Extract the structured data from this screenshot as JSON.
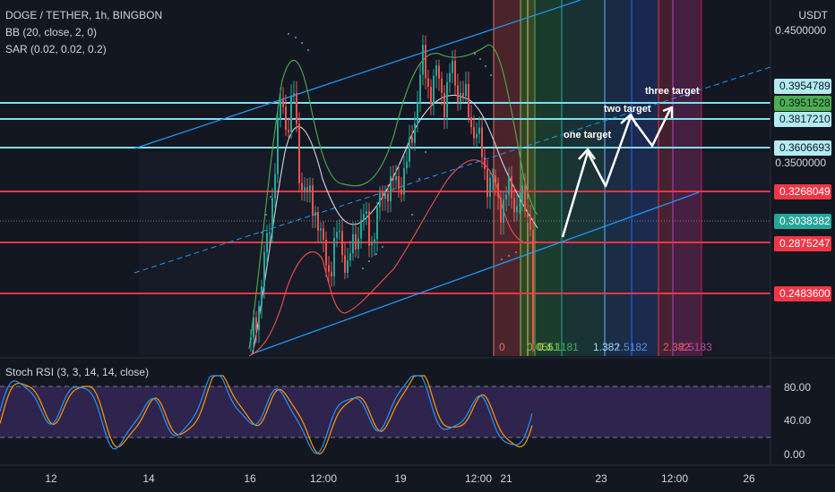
{
  "header": {
    "symbol": "DOGE / TETHER, 1h, BINGBON",
    "bb": "BB (20, close, 2, 0)",
    "sar": "SAR (0.02, 0.02, 0.2)",
    "stoch": "Stoch RSI (3, 3, 14, 14, close)"
  },
  "axis": {
    "currency": "USDT",
    "ticks": [
      "0.4500000",
      "0.3500000"
    ]
  },
  "price_labels": [
    {
      "value": "0.3954789",
      "bg": "#b2ebf2",
      "fg": "#131722"
    },
    {
      "value": "0.3951528",
      "bg": "#4caf50",
      "fg": "#131722"
    },
    {
      "value": "0.3817210",
      "bg": "#b2ebf2",
      "fg": "#131722"
    },
    {
      "value": "0.3606693",
      "bg": "#b2ebf2",
      "fg": "#131722"
    },
    {
      "value": "0.3268049",
      "bg": "#f23645",
      "fg": "#ffffff"
    },
    {
      "value": "0.3038382",
      "bg": "#26a69a",
      "fg": "#ffffff"
    },
    {
      "value": "0.2875247",
      "bg": "#f23645",
      "fg": "#ffffff"
    },
    {
      "value": "0.2483600",
      "bg": "#f23645",
      "fg": "#ffffff"
    }
  ],
  "time_axis": [
    "12",
    "14",
    "16",
    "12:00",
    "19",
    "12:00",
    "21",
    "23",
    "12:00",
    "26"
  ],
  "oscillator_ticks": [
    "80.00",
    "40.00",
    "0.00"
  ],
  "fib_labels": [
    {
      "text": "0",
      "color": "#e0705f"
    },
    {
      "text": "0.0551",
      "color": "#8bc34a"
    },
    {
      "text": "0.1",
      "color": "#c6d35a"
    },
    {
      "text": "0.1181",
      "color": "#4caf50"
    },
    {
      "text": "1.382",
      "color": "#a6d8ff"
    },
    {
      "text": "1.5182",
      "color": "#5c8fd6"
    },
    {
      "text": "2.382",
      "color": "#e0605f"
    },
    {
      "text": "2.5183",
      "color": "#c04a9c"
    }
  ],
  "annotations": {
    "one": "one target",
    "two": "two target",
    "three": "three target"
  },
  "colors": {
    "background": "#131722",
    "bullish": "#26a69a",
    "bearish": "#ef5350",
    "channel": "#2196f3",
    "resistance": "#80deea",
    "support": "#f23645",
    "stoch_k": "#2196f3",
    "stoch_d": "#ff9800",
    "stoch_band": "#7e57c2"
  }
}
